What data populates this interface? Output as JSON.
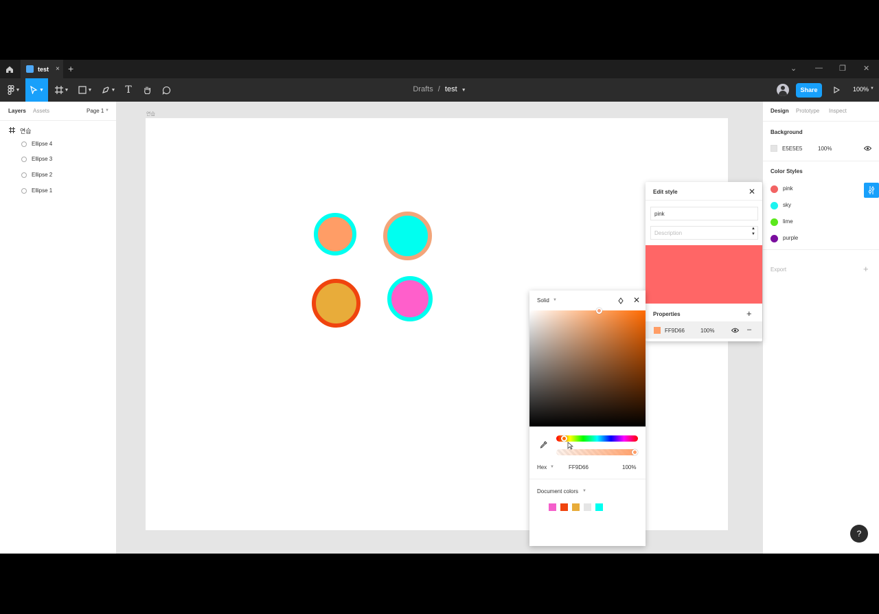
{
  "tab": {
    "name": "test",
    "close": "×",
    "new": "+"
  },
  "window": {
    "minimize": "—",
    "restore": "❐",
    "close": "✕",
    "more": "⌄"
  },
  "toolbar": {
    "breadcrumb_parent": "Drafts",
    "breadcrumb_sep": "/",
    "file_name": "test",
    "share_label": "Share",
    "zoom": "100%",
    "text_tool": "T"
  },
  "left_panel": {
    "tabs": {
      "layers": "Layers",
      "assets": "Assets",
      "page": "Page 1"
    },
    "frame_name": "연습",
    "layers": [
      {
        "label": "Ellipse 4"
      },
      {
        "label": "Ellipse 3"
      },
      {
        "label": "Ellipse 2"
      },
      {
        "label": "Ellipse 1"
      }
    ]
  },
  "canvas": {
    "frame_label": "연습",
    "ellipses": [
      {
        "name": "ellipse-1",
        "fill": "#FF9D66",
        "stroke": "#00FFF0"
      },
      {
        "name": "ellipse-2",
        "fill": "#00FFF0",
        "stroke": "#F2A57A"
      },
      {
        "name": "ellipse-3",
        "fill": "#E8AC3A",
        "stroke": "#F0440E"
      },
      {
        "name": "ellipse-4",
        "fill": "#FF5FCB",
        "stroke": "#00FFF0"
      }
    ]
  },
  "right_panel": {
    "tabs": {
      "design": "Design",
      "prototype": "Prototype",
      "inspect": "Inspect"
    },
    "background": {
      "title": "Background",
      "hex": "E5E5E5",
      "opacity": "100%",
      "color": "#E5E5E5"
    },
    "color_styles": {
      "title": "Color Styles",
      "items": [
        {
          "label": "pink",
          "color": "#F26363"
        },
        {
          "label": "sky",
          "color": "#1CF4F0"
        },
        {
          "label": "lime",
          "color": "#5BE81C"
        },
        {
          "label": "purple",
          "color": "#7A0E9E"
        }
      ]
    },
    "export": {
      "title": "Export",
      "add": "+"
    }
  },
  "edit_style": {
    "title": "Edit style",
    "name_value": "pink",
    "description_placeholder": "Description",
    "preview_color": "#FF6666",
    "properties": {
      "title": "Properties",
      "hex": "FF9D66",
      "opacity": "100%",
      "swatch": "#FF9D66"
    }
  },
  "color_picker": {
    "mode": "Solid",
    "hex_label": "Hex",
    "hex_value": "FF9D66",
    "opacity": "100%",
    "document_colors_label": "Document colors",
    "document_colors": [
      "#F45FCB",
      "#F0440E",
      "#E8AC3A",
      "#E5E5E5",
      "#00FFF0"
    ]
  },
  "help": {
    "label": "?"
  }
}
